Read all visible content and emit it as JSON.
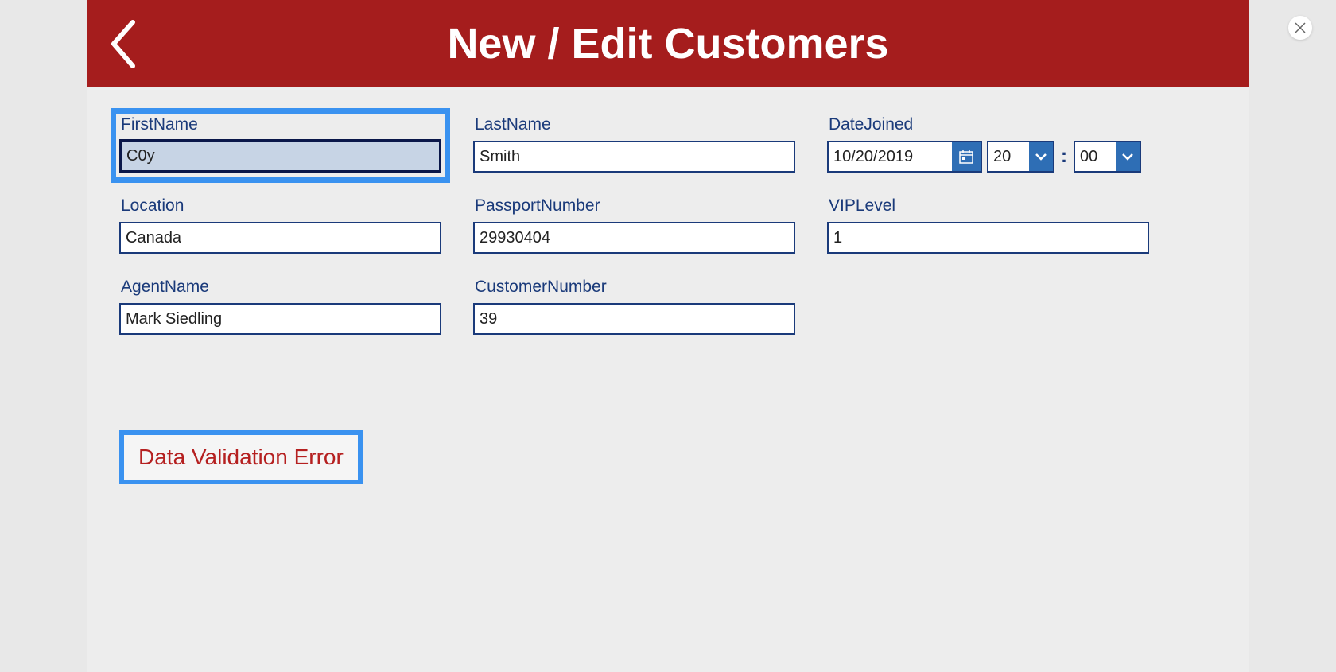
{
  "header": {
    "title": "New / Edit Customers"
  },
  "fields": {
    "firstName": {
      "label": "FirstName",
      "value": "C0y"
    },
    "lastName": {
      "label": "LastName",
      "value": "Smith"
    },
    "dateJoined": {
      "label": "DateJoined",
      "date": "10/20/2019",
      "hour": "20",
      "minute": "00"
    },
    "location": {
      "label": "Location",
      "value": "Canada"
    },
    "passportNumber": {
      "label": "PassportNumber",
      "value": "29930404"
    },
    "vipLevel": {
      "label": "VIPLevel",
      "value": "1"
    },
    "agentName": {
      "label": "AgentName",
      "value": "Mark Siedling"
    },
    "customerNumber": {
      "label": "CustomerNumber",
      "value": "39"
    }
  },
  "error": {
    "message": "Data Validation Error"
  },
  "timeSeparator": ":"
}
